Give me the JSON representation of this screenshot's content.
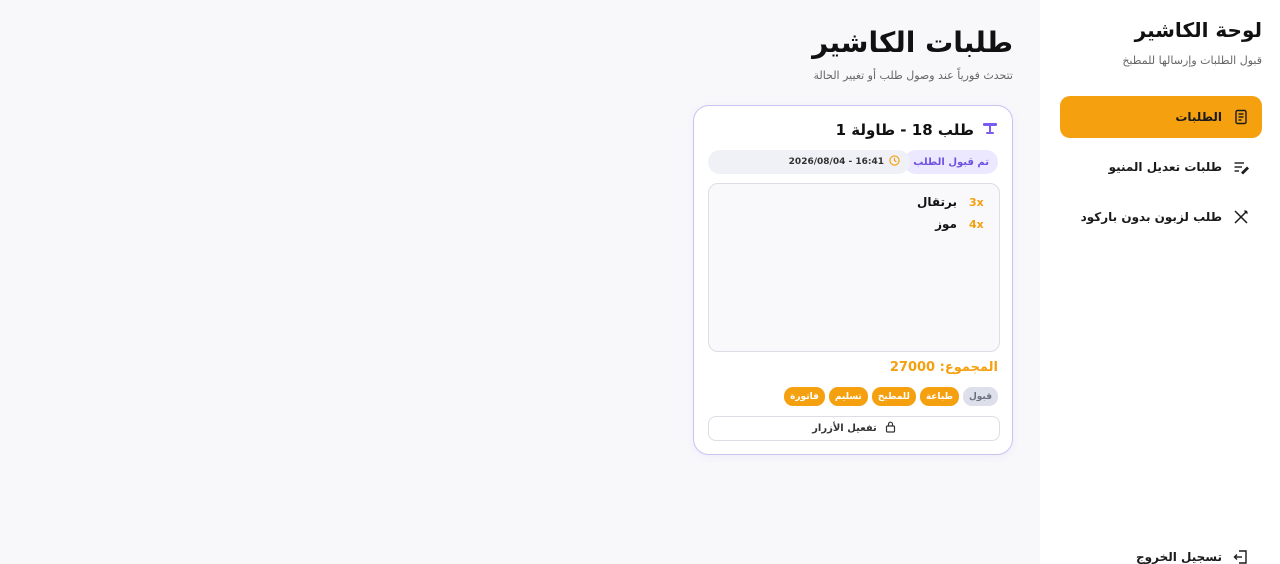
{
  "sidebar": {
    "title": "لوحة الكاشير",
    "subtitle": "قبول الطلبات وإرسالها للمطبخ",
    "items": [
      {
        "label": "الطلبات",
        "icon": "receipt-icon",
        "active": true
      },
      {
        "label": "طلبات تعديل المنيو",
        "icon": "edit-list-icon",
        "active": false
      },
      {
        "label": "طلب لزبون بدون باركود",
        "icon": "utensils-icon",
        "active": false
      }
    ],
    "logout_label": "تسجيل الخروج"
  },
  "main": {
    "title": "طلبات الكاشير",
    "subtitle": "تتحدث فورياً عند وصول طلب أو تغيير الحالة"
  },
  "order": {
    "title": "طلب 18 - طاولة 1",
    "icon": "table-icon",
    "status": "تم قبول الطلب",
    "datetime": "2026/08/04 - 16:41",
    "items": [
      {
        "qty": "3x",
        "name": "برتقال"
      },
      {
        "qty": "4x",
        "name": "موز"
      }
    ],
    "total": "المجموع: 27000",
    "actions": [
      {
        "label": "قبول",
        "enabled": false
      },
      {
        "label": "طباعة",
        "enabled": true
      },
      {
        "label": "للمطبخ",
        "enabled": true
      },
      {
        "label": "تسليم",
        "enabled": true
      },
      {
        "label": "فاتورة",
        "enabled": true
      }
    ],
    "enable_buttons_label": "تفعيل الأزرار"
  },
  "colors": {
    "accent": "#f5a00f",
    "status_purple": "#6f52e0",
    "card_border": "#c9c3f0"
  }
}
